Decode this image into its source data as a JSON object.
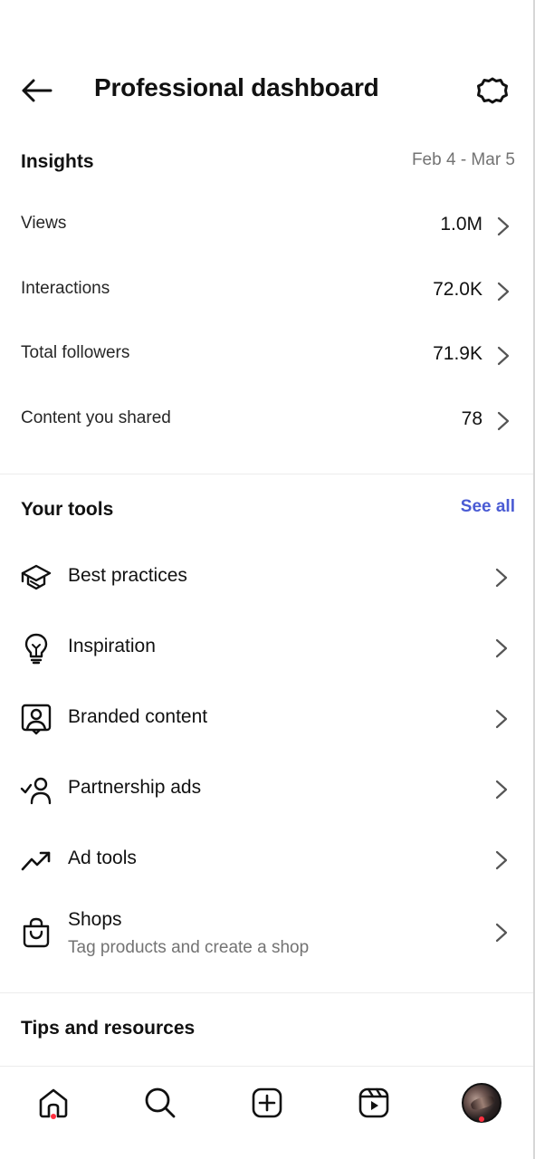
{
  "header": {
    "title": "Professional dashboard",
    "back_icon": "arrow-left-icon",
    "settings_icon": "gear-icon"
  },
  "insights": {
    "title": "Insights",
    "date_range": "Feb 4 - Mar 5",
    "rows": [
      {
        "label": "Views",
        "value": "1.0M"
      },
      {
        "label": "Interactions",
        "value": "72.0K"
      },
      {
        "label": "Total followers",
        "value": "71.9K"
      },
      {
        "label": "Content you shared",
        "value": "78"
      }
    ]
  },
  "tools": {
    "title": "Your tools",
    "see_all": "See all",
    "accent_color": "#4a5bd4",
    "items": [
      {
        "label": "Best practices",
        "icon": "graduation-cap-icon"
      },
      {
        "label": "Inspiration",
        "icon": "lightbulb-icon"
      },
      {
        "label": "Branded content",
        "icon": "branded-content-icon"
      },
      {
        "label": "Partnership ads",
        "icon": "partnership-check-icon"
      },
      {
        "label": "Ad tools",
        "icon": "trending-up-icon"
      },
      {
        "label": "Shops",
        "sublabel": "Tag products and create a shop",
        "icon": "shopping-bag-icon"
      }
    ]
  },
  "tips": {
    "title": "Tips and resources"
  },
  "bottom_nav": {
    "items": [
      "home-icon",
      "search-icon",
      "create-icon",
      "reels-icon",
      "profile-avatar"
    ],
    "notification_color": "#ff3040"
  }
}
